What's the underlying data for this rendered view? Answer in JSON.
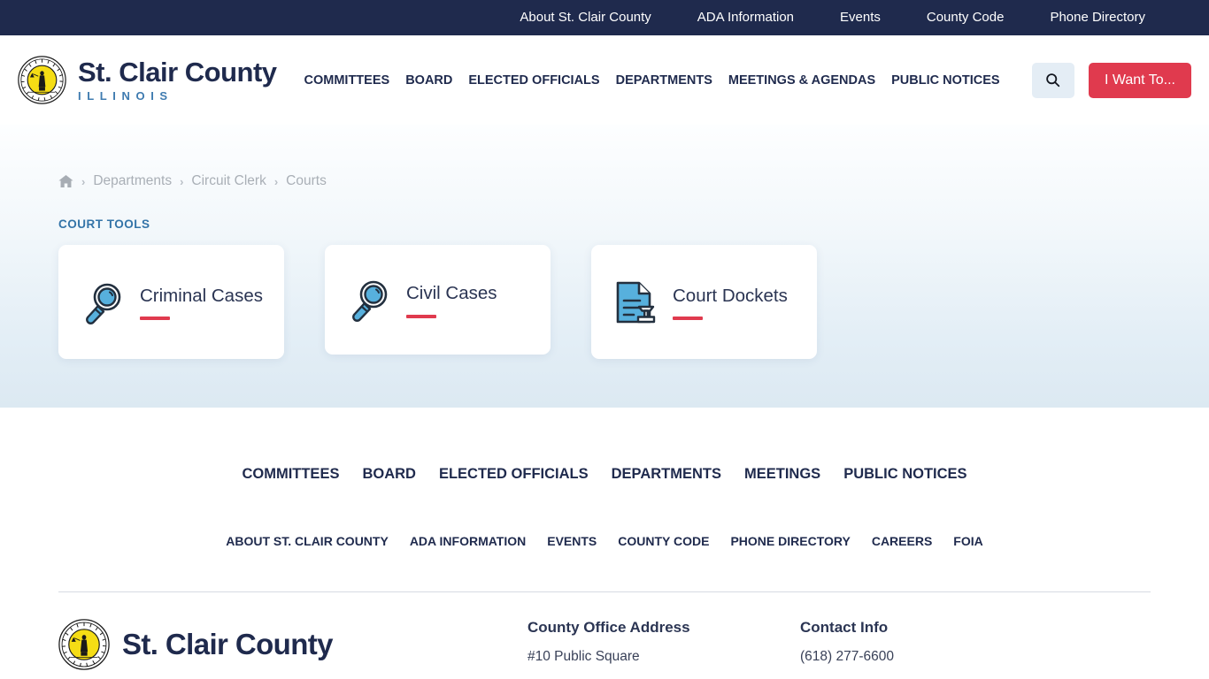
{
  "topbar": {
    "links": [
      {
        "label": "About St. Clair County"
      },
      {
        "label": "ADA Information"
      },
      {
        "label": "Events"
      },
      {
        "label": "County Code"
      },
      {
        "label": "Phone Directory"
      }
    ]
  },
  "header": {
    "brand": {
      "name": "St. Clair County",
      "subtitle": "ILLINOIS",
      "seal_icon": "county-seal-icon"
    },
    "nav": [
      {
        "label": "COMMITTEES"
      },
      {
        "label": "BOARD"
      },
      {
        "label": "ELECTED OFFICIALS"
      },
      {
        "label": "DEPARTMENTS"
      },
      {
        "label": "MEETINGS & AGENDAS"
      },
      {
        "label": "PUBLIC NOTICES"
      }
    ],
    "search_icon": "search-icon",
    "i_want_to_label": "I Want To..."
  },
  "hero": {
    "breadcrumb": {
      "home_icon": "home-icon",
      "separator": "›",
      "items": [
        {
          "label": "Departments"
        },
        {
          "label": "Circuit Clerk"
        },
        {
          "label": "Courts"
        }
      ]
    },
    "section_label": "COURT TOOLS",
    "cards": [
      {
        "title": "Criminal Cases",
        "icon": "magnifying-glass-icon"
      },
      {
        "title": "Civil Cases",
        "icon": "magnifying-glass-icon"
      },
      {
        "title": "Court Dockets",
        "icon": "document-stamp-icon"
      }
    ]
  },
  "footer": {
    "nav_primary": [
      {
        "label": "COMMITTEES"
      },
      {
        "label": "BOARD"
      },
      {
        "label": "ELECTED OFFICIALS"
      },
      {
        "label": "DEPARTMENTS"
      },
      {
        "label": "MEETINGS"
      },
      {
        "label": "PUBLIC NOTICES"
      }
    ],
    "nav_secondary": [
      {
        "label": "ABOUT ST. CLAIR COUNTY"
      },
      {
        "label": "ADA INFORMATION"
      },
      {
        "label": "EVENTS"
      },
      {
        "label": "COUNTY CODE"
      },
      {
        "label": "PHONE DIRECTORY"
      },
      {
        "label": "CAREERS"
      },
      {
        "label": "FOIA"
      }
    ],
    "brand_name": "St. Clair County",
    "address": {
      "heading": "County Office Address",
      "line1": "#10 Public Square"
    },
    "contact": {
      "heading": "Contact Info",
      "line1": "(618) 277-6600"
    }
  },
  "colors": {
    "navy": "#1f2a4d",
    "red": "#e03a4e",
    "blue_accent": "#3374a8",
    "icon_blue": "#5cb3de",
    "hero_bottom": "#dce9f2"
  }
}
